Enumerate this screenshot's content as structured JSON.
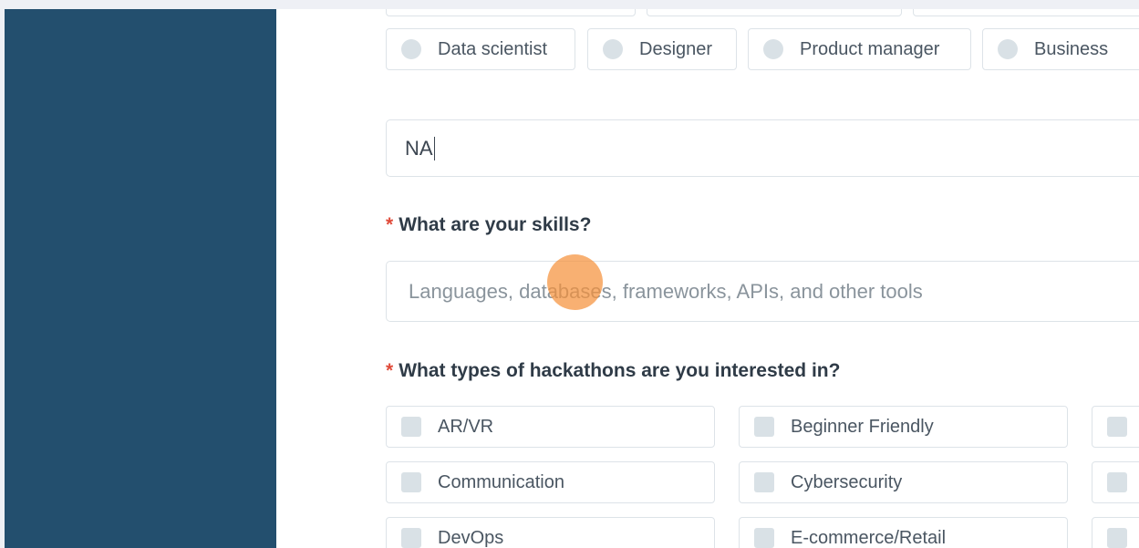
{
  "roles": [
    "Data scientist",
    "Designer",
    "Product manager",
    "Business"
  ],
  "other_role_value": "NA",
  "skills": {
    "label": "What are your skills?",
    "required_marker": "*",
    "placeholder": "Languages, databases, frameworks, APIs, and other tools"
  },
  "hackathons": {
    "label": "What types of hackathons are you interested in?",
    "required_marker": "*",
    "column1": [
      "AR/VR",
      "Communication",
      "DevOps"
    ],
    "column2": [
      "Beginner Friendly",
      "Cybersecurity",
      "E-commerce/Retail"
    ]
  },
  "colors": {
    "sidebar": "#234f6e",
    "required": "#e04b3a",
    "cursor_highlight": "#f5913c"
  }
}
